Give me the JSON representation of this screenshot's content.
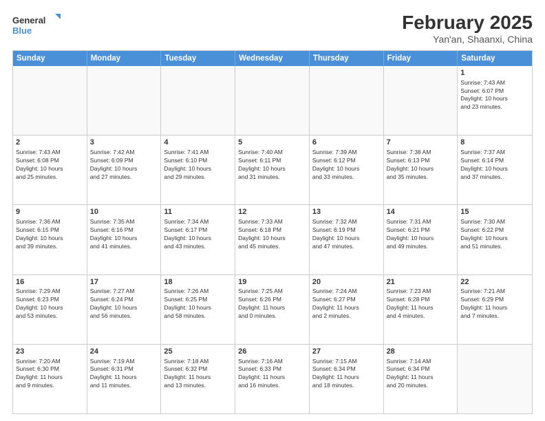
{
  "header": {
    "logo": {
      "line1": "General",
      "line2": "Blue"
    },
    "title": "February 2025",
    "location": "Yan'an, Shaanxi, China"
  },
  "weekdays": [
    "Sunday",
    "Monday",
    "Tuesday",
    "Wednesday",
    "Thursday",
    "Friday",
    "Saturday"
  ],
  "weeks": [
    [
      {
        "day": "",
        "empty": true
      },
      {
        "day": "",
        "empty": true
      },
      {
        "day": "",
        "empty": true
      },
      {
        "day": "",
        "empty": true
      },
      {
        "day": "",
        "empty": true
      },
      {
        "day": "",
        "empty": true
      },
      {
        "day": "1",
        "lines": [
          "Sunrise: 7:43 AM",
          "Sunset: 6:07 PM",
          "Daylight: 10 hours",
          "and 23 minutes."
        ]
      }
    ],
    [
      {
        "day": "2",
        "lines": [
          "Sunrise: 7:43 AM",
          "Sunset: 6:08 PM",
          "Daylight: 10 hours",
          "and 25 minutes."
        ]
      },
      {
        "day": "3",
        "lines": [
          "Sunrise: 7:42 AM",
          "Sunset: 6:09 PM",
          "Daylight: 10 hours",
          "and 27 minutes."
        ]
      },
      {
        "day": "4",
        "lines": [
          "Sunrise: 7:41 AM",
          "Sunset: 6:10 PM",
          "Daylight: 10 hours",
          "and 29 minutes."
        ]
      },
      {
        "day": "5",
        "lines": [
          "Sunrise: 7:40 AM",
          "Sunset: 6:11 PM",
          "Daylight: 10 hours",
          "and 31 minutes."
        ]
      },
      {
        "day": "6",
        "lines": [
          "Sunrise: 7:39 AM",
          "Sunset: 6:12 PM",
          "Daylight: 10 hours",
          "and 33 minutes."
        ]
      },
      {
        "day": "7",
        "lines": [
          "Sunrise: 7:38 AM",
          "Sunset: 6:13 PM",
          "Daylight: 10 hours",
          "and 35 minutes."
        ]
      },
      {
        "day": "8",
        "lines": [
          "Sunrise: 7:37 AM",
          "Sunset: 6:14 PM",
          "Daylight: 10 hours",
          "and 37 minutes."
        ]
      }
    ],
    [
      {
        "day": "9",
        "lines": [
          "Sunrise: 7:36 AM",
          "Sunset: 6:15 PM",
          "Daylight: 10 hours",
          "and 39 minutes."
        ]
      },
      {
        "day": "10",
        "lines": [
          "Sunrise: 7:35 AM",
          "Sunset: 6:16 PM",
          "Daylight: 10 hours",
          "and 41 minutes."
        ]
      },
      {
        "day": "11",
        "lines": [
          "Sunrise: 7:34 AM",
          "Sunset: 6:17 PM",
          "Daylight: 10 hours",
          "and 43 minutes."
        ]
      },
      {
        "day": "12",
        "lines": [
          "Sunrise: 7:33 AM",
          "Sunset: 6:18 PM",
          "Daylight: 10 hours",
          "and 45 minutes."
        ]
      },
      {
        "day": "13",
        "lines": [
          "Sunrise: 7:32 AM",
          "Sunset: 6:19 PM",
          "Daylight: 10 hours",
          "and 47 minutes."
        ]
      },
      {
        "day": "14",
        "lines": [
          "Sunrise: 7:31 AM",
          "Sunset: 6:21 PM",
          "Daylight: 10 hours",
          "and 49 minutes."
        ]
      },
      {
        "day": "15",
        "lines": [
          "Sunrise: 7:30 AM",
          "Sunset: 6:22 PM",
          "Daylight: 10 hours",
          "and 51 minutes."
        ]
      }
    ],
    [
      {
        "day": "16",
        "lines": [
          "Sunrise: 7:29 AM",
          "Sunset: 6:23 PM",
          "Daylight: 10 hours",
          "and 53 minutes."
        ]
      },
      {
        "day": "17",
        "lines": [
          "Sunrise: 7:27 AM",
          "Sunset: 6:24 PM",
          "Daylight: 10 hours",
          "and 56 minutes."
        ]
      },
      {
        "day": "18",
        "lines": [
          "Sunrise: 7:26 AM",
          "Sunset: 6:25 PM",
          "Daylight: 10 hours",
          "and 58 minutes."
        ]
      },
      {
        "day": "19",
        "lines": [
          "Sunrise: 7:25 AM",
          "Sunset: 6:26 PM",
          "Daylight: 11 hours",
          "and 0 minutes."
        ]
      },
      {
        "day": "20",
        "lines": [
          "Sunrise: 7:24 AM",
          "Sunset: 6:27 PM",
          "Daylight: 11 hours",
          "and 2 minutes."
        ]
      },
      {
        "day": "21",
        "lines": [
          "Sunrise: 7:23 AM",
          "Sunset: 6:28 PM",
          "Daylight: 11 hours",
          "and 4 minutes."
        ]
      },
      {
        "day": "22",
        "lines": [
          "Sunrise: 7:21 AM",
          "Sunset: 6:29 PM",
          "Daylight: 11 hours",
          "and 7 minutes."
        ]
      }
    ],
    [
      {
        "day": "23",
        "lines": [
          "Sunrise: 7:20 AM",
          "Sunset: 6:30 PM",
          "Daylight: 11 hours",
          "and 9 minutes."
        ]
      },
      {
        "day": "24",
        "lines": [
          "Sunrise: 7:19 AM",
          "Sunset: 6:31 PM",
          "Daylight: 11 hours",
          "and 11 minutes."
        ]
      },
      {
        "day": "25",
        "lines": [
          "Sunrise: 7:18 AM",
          "Sunset: 6:32 PM",
          "Daylight: 11 hours",
          "and 13 minutes."
        ]
      },
      {
        "day": "26",
        "lines": [
          "Sunrise: 7:16 AM",
          "Sunset: 6:33 PM",
          "Daylight: 11 hours",
          "and 16 minutes."
        ]
      },
      {
        "day": "27",
        "lines": [
          "Sunrise: 7:15 AM",
          "Sunset: 6:34 PM",
          "Daylight: 11 hours",
          "and 18 minutes."
        ]
      },
      {
        "day": "28",
        "lines": [
          "Sunrise: 7:14 AM",
          "Sunset: 6:34 PM",
          "Daylight: 11 hours",
          "and 20 minutes."
        ]
      },
      {
        "day": "",
        "empty": true
      }
    ]
  ]
}
